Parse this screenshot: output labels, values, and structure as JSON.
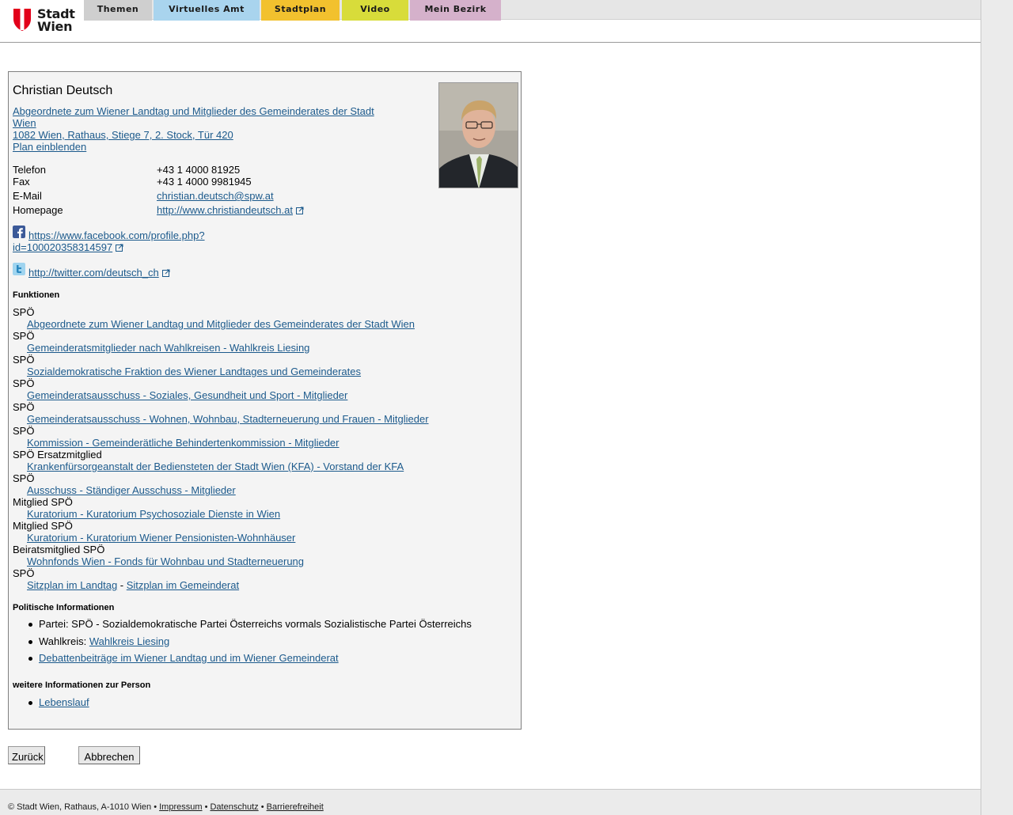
{
  "header": {
    "logo_line1": "Stadt",
    "logo_line2": "Wien",
    "tabs": [
      {
        "label": "Themen",
        "color": "#cfcfcf"
      },
      {
        "label": "Virtuelles Amt",
        "color": "#a9d4ee"
      },
      {
        "label": "Stadtplan",
        "color": "#f2c12e"
      },
      {
        "label": "Video",
        "color": "#d8dc3a"
      },
      {
        "label": "Mein Bezirk",
        "color": "#d5b1cb"
      }
    ]
  },
  "person": {
    "name": "Christian Deutsch",
    "role_line1": "Abgeordnete zum Wiener Landtag und Mitglieder des Gemeinderates der Stadt",
    "role_line2": "Wien ",
    "address": "1082 Wien, Rathaus, Stiege 7, 2. Stock, Tür 420",
    "map_link": "Plan einblenden"
  },
  "contact": {
    "phone_label": "Telefon",
    "phone": "+43 1 4000 81925",
    "fax_label": "Fax",
    "fax": "+43 1 4000 9981945",
    "email_label": "E-Mail",
    "email": "christian.deutsch@spw.at",
    "homepage_label": "Homepage",
    "homepage": "http://www.christiandeutsch.at"
  },
  "social": {
    "facebook_line1": "https://www.facebook.com/profile.php?",
    "facebook_line2": "id=100020358314597",
    "twitter": "http://twitter.com/deutsch_ch"
  },
  "functions": {
    "heading": "Funktionen",
    "items": [
      {
        "party": "SPÖ",
        "link": "Abgeordnete zum Wiener Landtag und Mitglieder des Gemeinderates der Stadt Wien"
      },
      {
        "party": "SPÖ",
        "link": "Gemeinderatsmitglieder nach Wahlkreisen - Wahlkreis Liesing"
      },
      {
        "party": "SPÖ",
        "link": "Sozialdemokratische Fraktion des Wiener Landtages und Gemeinderates"
      },
      {
        "party": "SPÖ",
        "link": "Gemeinderatsausschuss - Soziales, Gesundheit und Sport - Mitglieder"
      },
      {
        "party": "SPÖ",
        "link": "Gemeinderatsausschuss - Wohnen, Wohnbau, Stadterneuerung und Frauen - Mitglieder"
      },
      {
        "party": "SPÖ",
        "link": "Kommission - Gemeinderätliche Behindertenkommission - Mitglieder"
      },
      {
        "party": "SPÖ Ersatzmitglied",
        "link": "Krankenfürsorgeanstalt der Bediensteten der Stadt Wien (KFA) - Vorstand der KFA"
      },
      {
        "party": "SPÖ",
        "link": "Ausschuss - Ständiger Ausschuss - Mitglieder"
      },
      {
        "party": "Mitglied SPÖ",
        "link": "Kuratorium - Kuratorium Psychosoziale Dienste in Wien"
      },
      {
        "party": "Mitglied SPÖ",
        "link": "Kuratorium - Kuratorium Wiener Pensionisten-Wohnhäuser"
      },
      {
        "party": "Beiratsmitglied SPÖ",
        "link": "Wohnfonds Wien - Fonds für Wohnbau und Stadterneuerung"
      },
      {
        "party": "SPÖ",
        "link": ""
      }
    ],
    "seat_landtag": "Sitzplan im Landtag",
    "seat_sep": " - ",
    "seat_gemeinderat": "Sitzplan im Gemeinderat"
  },
  "political": {
    "heading": "Politische Informationen",
    "party_text": "Partei: SPÖ - Sozialdemokratische Partei Österreichs vormals Sozialistische Partei Österreichs",
    "district_label": "Wahlkreis: ",
    "district_link": "Wahlkreis Liesing",
    "debates_link": "Debattenbeiträge im Wiener Landtag und im Wiener Gemeinderat"
  },
  "more": {
    "heading": "weitere Informationen zur Person",
    "cv_link": "Lebenslauf"
  },
  "buttons": {
    "back": "Zurück",
    "cancel": "Abbrechen"
  },
  "footer": {
    "copyright": "© Stadt Wien, Rathaus, A-1010 Wien",
    "sep": " • ",
    "impressum": "Impressum",
    "datenschutz": "Datenschutz",
    "barrierefreiheit": "Barrierefreiheit"
  }
}
